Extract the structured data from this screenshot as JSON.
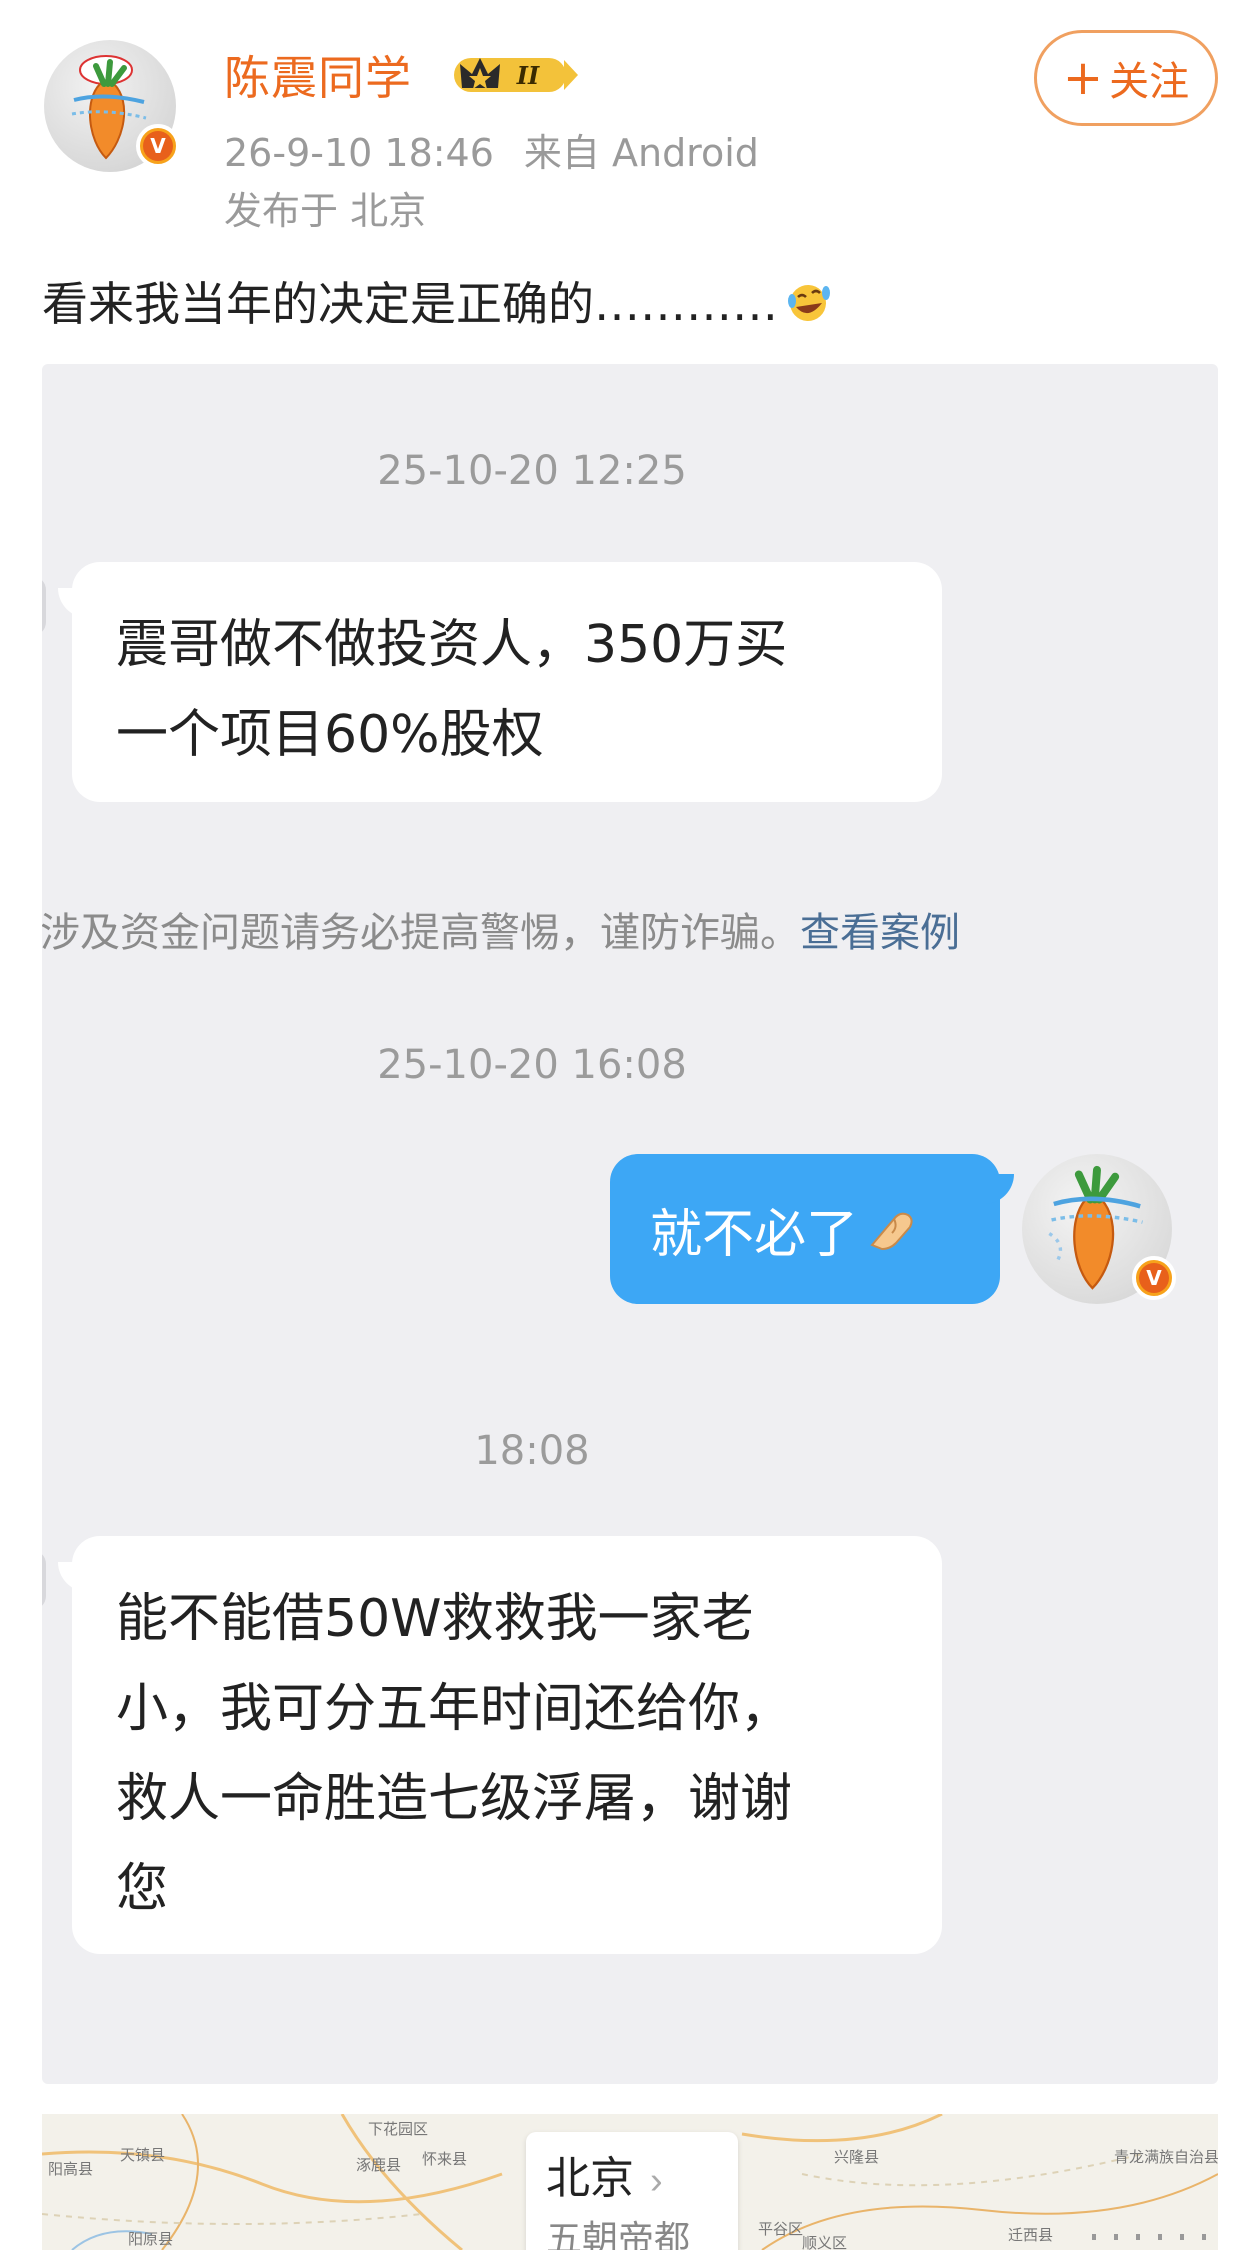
{
  "post": {
    "username": "陈震同学",
    "vip_level": "II",
    "timestamp": "26-9-10 18:46",
    "source": "来自 Android",
    "location": "发布于 北京",
    "follow_label": "关注",
    "text": "看来我当年的决定是正确的…………",
    "emoji": "laughing-tears-icon"
  },
  "chat": {
    "messages": [
      {
        "timestamp": "25-10-20 12:25"
      },
      {
        "text_line1": "震哥做不做投资人，350万买",
        "text_line2": "一个项目60%股权"
      },
      {
        "warning": "涉及资金问题请务必提高警惕，谨防诈骗。",
        "warning_link": "查看案例"
      },
      {
        "timestamp": "25-10-20 16:08"
      },
      {
        "text": "就不必了",
        "emoji": "pinched-hand-icon"
      },
      {
        "timestamp": "18:08"
      },
      {
        "text_line1": "能不能借50W救救我一家老",
        "text_line2": "小，我可分五年时间还给你，",
        "text_line3": "救人一命胜造七级浮屠，谢谢",
        "text_line4": "您"
      }
    ]
  },
  "map": {
    "city": "北京",
    "description": "五朝帝都",
    "labels": [
      "阳高县",
      "天镇县",
      "下花园区",
      "怀来县",
      "涿鹿县",
      "兴隆县",
      "青龙满族自治县",
      "阳原县",
      "平谷区",
      "迁西县",
      "顺义区"
    ]
  },
  "colors": {
    "accent_orange": "#ec6a1f",
    "bubble_blue": "#3da7f5",
    "chat_bg": "#efeff2",
    "link_blue": "#4a6e95"
  }
}
